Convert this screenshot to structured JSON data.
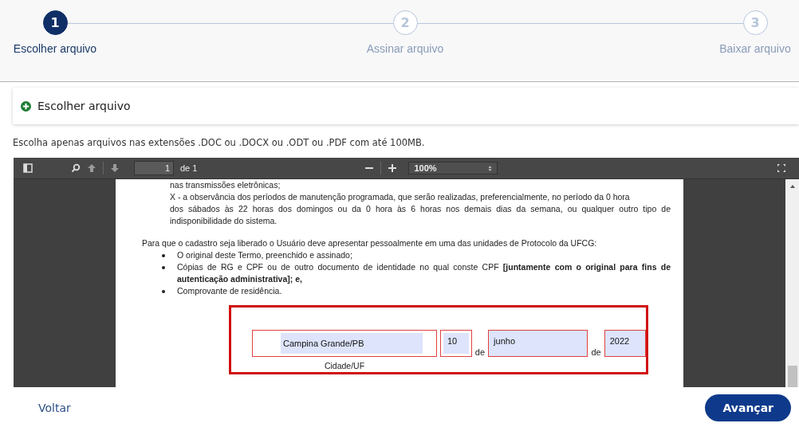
{
  "steps": [
    {
      "number": "1",
      "label": "Escolher arquivo",
      "selected": true
    },
    {
      "number": "2",
      "label": "Assinar arquivo",
      "selected": false
    },
    {
      "number": "3",
      "label": "Baixar arquivo",
      "selected": false
    }
  ],
  "choose_file": {
    "label": "Escolher arquivo"
  },
  "hint": "Escolha apenas arquivos nas extensões .DOC ou .DOCX ou .ODT ou .PDF com até 100MB.",
  "viewer": {
    "page": "1",
    "page_total": "de 1",
    "zoom": "100%",
    "document": [
      {
        "kind": "line",
        "text": "nas transmissões eletrônicas;",
        "justify": false,
        "indent": true
      },
      {
        "kind": "line",
        "text": "X - a observância dos períodos de manutenção programada, que serão realizadas, preferencialmente, no período da 0 hora",
        "justify": false,
        "indent": true
      },
      {
        "kind": "line",
        "text": "dos sábados às 22 horas dos domingos ou da 0 hora às 6 horas nos demais dias da semana, ou qualquer outro tipo de",
        "justify": true,
        "indent": true
      },
      {
        "kind": "line",
        "text": "indisponibilidade do sistema.",
        "justify": false,
        "indent": true
      },
      {
        "kind": "gap"
      },
      {
        "kind": "line",
        "text": "Para que o cadastro seja liberado o Usuário deve apresentar pessoalmente em uma das unidades de Protocolo da UFCG:",
        "justify": false,
        "indent": false
      },
      {
        "kind": "bullet",
        "text": "O original deste Termo, preenchido e  assinado;"
      },
      {
        "kind": "bullet",
        "text": "Cópias de RG e  CPF ou de outro documento de identidade no qual conste  CPF **[juntamente com o original para fins de autenticação administrativa]; e,**"
      },
      {
        "kind": "bullet",
        "text": "Comprovante de residência."
      }
    ],
    "form": {
      "city": "Campina Grande/PB",
      "day": "10",
      "month": "junho",
      "year": "2022",
      "joiner_1": "de",
      "joiner_2": "de",
      "caption": "Cidade/UF"
    }
  },
  "buttons": {
    "back": "Voltar",
    "next": "Avançar"
  }
}
